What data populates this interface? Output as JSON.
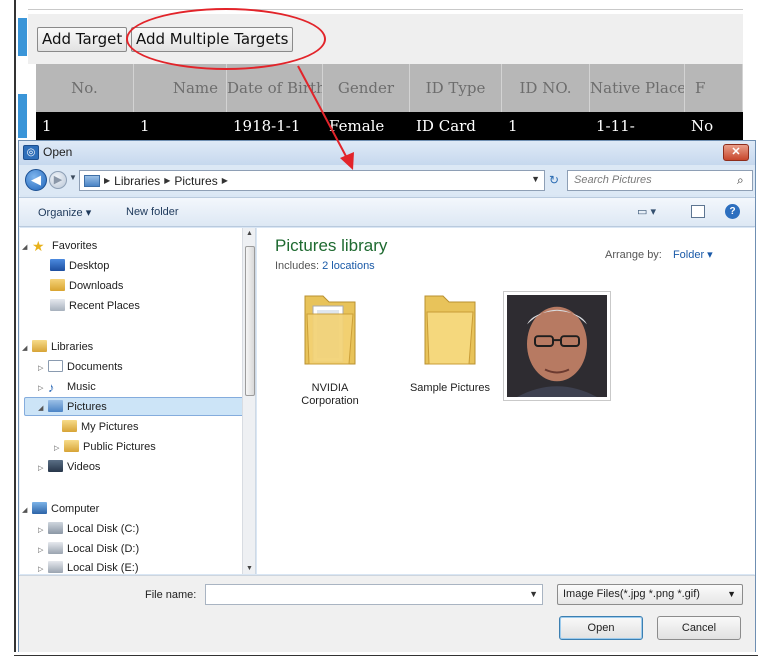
{
  "background": {
    "buttons": {
      "add_target": "Add Target",
      "add_multiple": "Add Multiple Targets"
    },
    "columns": [
      "No.",
      "Name",
      "Date of Birth",
      "Gender",
      "ID Type",
      "ID NO.",
      "Native Place",
      "F"
    ],
    "row": [
      "1",
      "1",
      "1918-1-1",
      "Female",
      "ID Card",
      "1",
      "1-11-",
      "No"
    ]
  },
  "dialog": {
    "title": "Open",
    "close_label": "✕",
    "breadcrumb": [
      "Libraries",
      "Pictures"
    ],
    "search_placeholder": "Search Pictures",
    "commands": {
      "organize": "Organize ▾",
      "new_folder": "New folder"
    },
    "nav": {
      "favorites": "Favorites",
      "desktop": "Desktop",
      "downloads": "Downloads",
      "recent_places": "Recent Places",
      "libraries": "Libraries",
      "documents": "Documents",
      "music": "Music",
      "pictures": "Pictures",
      "my_pictures": "My Pictures",
      "public_pictures": "Public Pictures",
      "videos": "Videos",
      "computer": "Computer",
      "disk_c": "Local Disk (C:)",
      "disk_d": "Local Disk (D:)",
      "disk_e": "Local Disk (E:)"
    },
    "library": {
      "title": "Pictures library",
      "includes_label": "Includes:",
      "includes_link": "2 locations",
      "arrange_label": "Arrange by:",
      "arrange_value": "Folder ▾"
    },
    "items": {
      "nvidia_line1": "NVIDIA",
      "nvidia_line2": "Corporation",
      "sample": "Sample Pictures"
    },
    "filename_label": "File name:",
    "filename_value": "",
    "filetype": "Image Files(*.jpg *.png *.gif)",
    "open_button": "Open",
    "cancel_button": "Cancel"
  },
  "colors": {
    "accent_blue": "#3a95d8",
    "annotation_red": "#e2242a",
    "library_green": "#1e6a30"
  }
}
